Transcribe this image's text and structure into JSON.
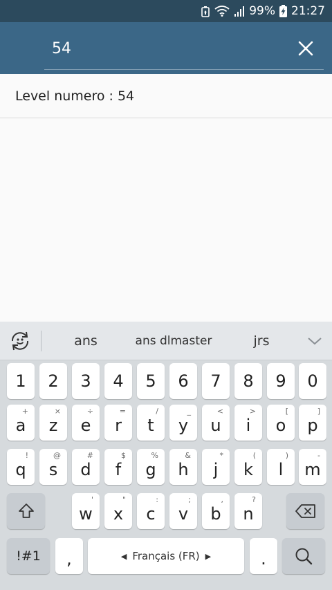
{
  "status_bar": {
    "battery_percent": "99%",
    "time": "21:27"
  },
  "search": {
    "value": "54",
    "clear_icon": "close-icon"
  },
  "results": [
    {
      "label": "Level numero : 54"
    }
  ],
  "keyboard": {
    "suggestions": [
      "ans",
      "ans dlmaster",
      "jrs"
    ],
    "rows": {
      "numbers": [
        "1",
        "2",
        "3",
        "4",
        "5",
        "6",
        "7",
        "8",
        "9",
        "0"
      ],
      "row1": [
        {
          "main": "a",
          "hint": "+"
        },
        {
          "main": "z",
          "hint": "×"
        },
        {
          "main": "e",
          "hint": "÷"
        },
        {
          "main": "r",
          "hint": "="
        },
        {
          "main": "t",
          "hint": "/"
        },
        {
          "main": "y",
          "hint": "_"
        },
        {
          "main": "u",
          "hint": "<"
        },
        {
          "main": "i",
          "hint": ">"
        },
        {
          "main": "o",
          "hint": "["
        },
        {
          "main": "p",
          "hint": "]"
        }
      ],
      "row2": [
        {
          "main": "q",
          "hint": "!"
        },
        {
          "main": "s",
          "hint": "@"
        },
        {
          "main": "d",
          "hint": "#"
        },
        {
          "main": "f",
          "hint": "$"
        },
        {
          "main": "g",
          "hint": "%"
        },
        {
          "main": "h",
          "hint": "&"
        },
        {
          "main": "j",
          "hint": "*"
        },
        {
          "main": "k",
          "hint": "("
        },
        {
          "main": "l",
          "hint": ")"
        },
        {
          "main": "m",
          "hint": "-"
        }
      ],
      "row3": [
        {
          "main": "w",
          "hint": "'"
        },
        {
          "main": "x",
          "hint": "\""
        },
        {
          "main": "c",
          "hint": ":"
        },
        {
          "main": "v",
          "hint": ";"
        },
        {
          "main": "b",
          "hint": ","
        },
        {
          "main": "n",
          "hint": "?"
        }
      ]
    },
    "symbols_label": "!#1",
    "comma_label": ",",
    "space_label": "Français (FR)",
    "period_label": ".",
    "shift_icon": "shift-icon",
    "backspace_icon": "backspace-icon",
    "search_icon": "search-icon"
  }
}
